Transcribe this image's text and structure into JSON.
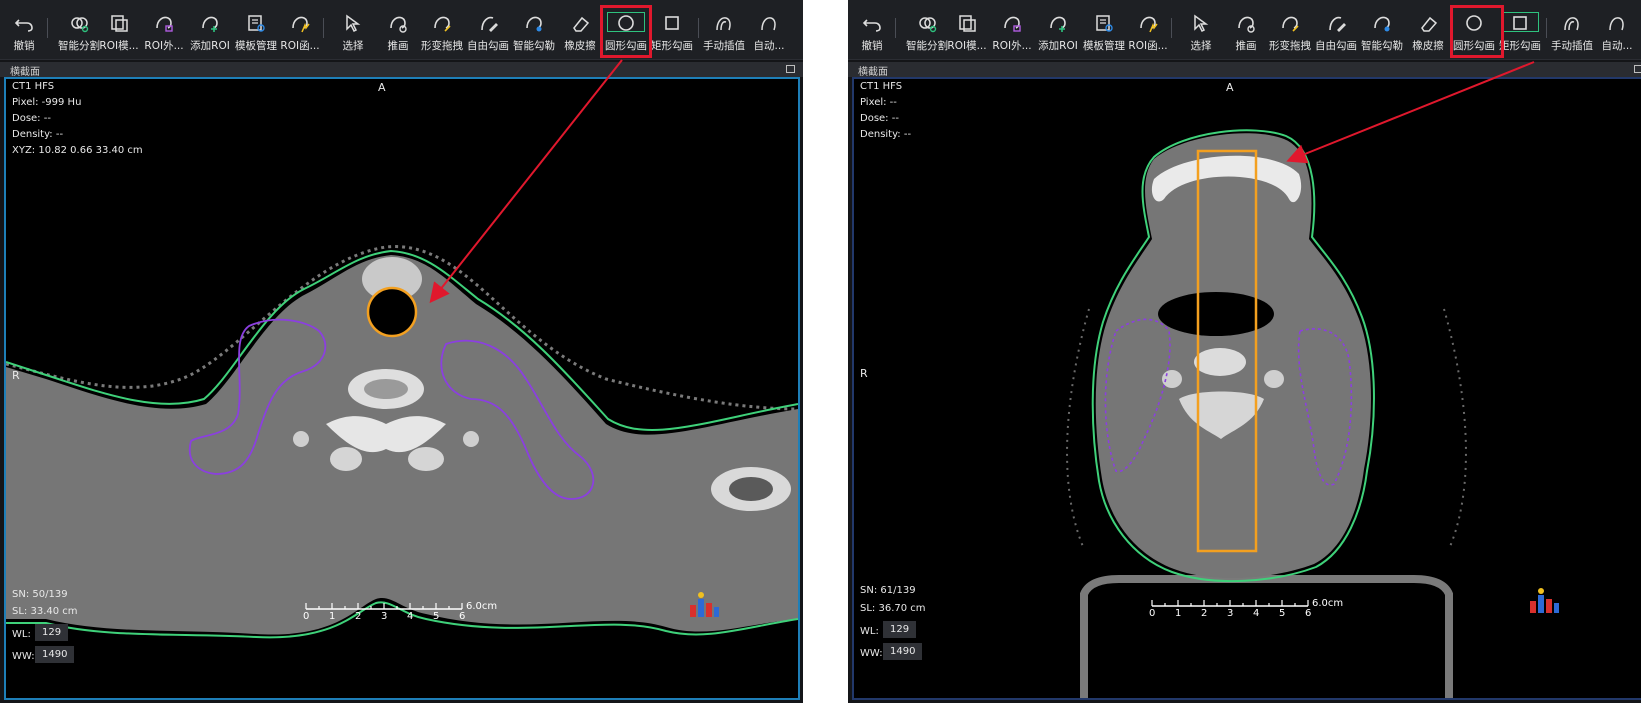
{
  "colors": {
    "accent_green": "#2ec27e",
    "highlight_red": "#e0182d",
    "arrow_red": "#e0182d",
    "contour_green": "#3fd17a",
    "contour_purple": "#8b3fe0",
    "roi_orange": "#f3a020",
    "viewport_border_active": "#1e7fb8"
  },
  "toolbar": {
    "items": [
      {
        "label": "撤销",
        "icon": "undo-icon"
      },
      {
        "label": "智能分割",
        "icon": "smart-segment-icon"
      },
      {
        "label": "ROI模...",
        "icon": "roi-template-icon"
      },
      {
        "label": "ROI外...",
        "icon": "roi-outer-icon"
      },
      {
        "label": "添加ROI",
        "icon": "add-roi-icon"
      },
      {
        "label": "模板管理",
        "icon": "template-manage-icon"
      },
      {
        "label": "ROI函...",
        "icon": "roi-function-icon"
      },
      {
        "label": "选择",
        "icon": "select-cursor-icon"
      },
      {
        "label": "推画",
        "icon": "push-draw-icon"
      },
      {
        "label": "形变拖拽",
        "icon": "deform-drag-icon"
      },
      {
        "label": "自由勾画",
        "icon": "free-draw-icon"
      },
      {
        "label": "智能勾勒",
        "icon": "smart-outline-icon"
      },
      {
        "label": "橡皮擦",
        "icon": "eraser-icon"
      },
      {
        "label": "圆形勾画",
        "icon": "circle-draw-icon"
      },
      {
        "label": "矩形勾画",
        "icon": "rect-draw-icon"
      },
      {
        "label": "手动插值",
        "icon": "manual-interp-icon"
      },
      {
        "label": "自动...",
        "icon": "auto-interp-icon"
      }
    ]
  },
  "left": {
    "active_tool": "圆形勾画",
    "viewport_title": "横截面",
    "orient_top": "A",
    "orient_left": "R",
    "info": {
      "series": "CT1 HFS",
      "pixel": "Pixel:  -999 Hu",
      "dose": "Dose:  --",
      "density": "Density:  --",
      "xyz": "XYZ: 10.82 0.66 33.40 cm"
    },
    "footer": {
      "sn": "SN: 50/139",
      "sl": "SL: 33.40 cm",
      "wl_label": "WL:",
      "wl_value": "129",
      "ww_label": "WW:",
      "ww_value": "1490"
    },
    "scale": {
      "ticks": [
        "0",
        "1",
        "2",
        "3",
        "4",
        "5",
        "6"
      ],
      "unit": "6.0cm"
    }
  },
  "right": {
    "active_tool": "矩形勾画",
    "viewport_title": "横截面",
    "orient_top": "A",
    "orient_left": "R",
    "info": {
      "series": "CT1 HFS",
      "pixel": "Pixel:  --",
      "dose": "Dose:  --",
      "density": "Density:  --"
    },
    "footer": {
      "sn": "SN: 61/139",
      "sl": "SL: 36.70 cm",
      "wl_label": "WL:",
      "wl_value": "129",
      "ww_label": "WW:",
      "ww_value": "1490"
    },
    "scale": {
      "ticks": [
        "0",
        "1",
        "2",
        "3",
        "4",
        "5",
        "6"
      ],
      "unit": "6.0cm"
    }
  }
}
